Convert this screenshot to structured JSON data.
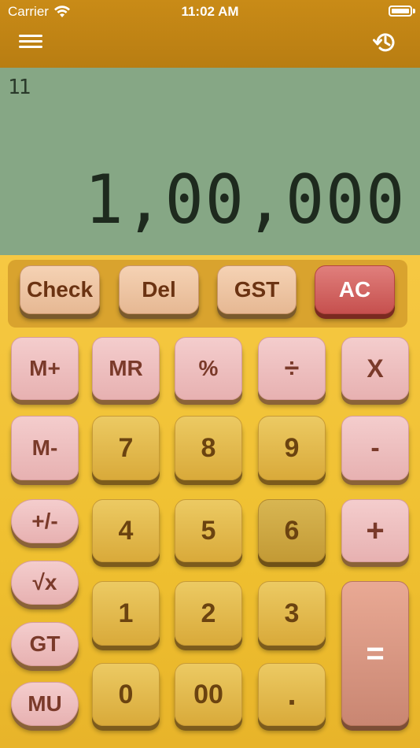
{
  "status": {
    "carrier": "Carrier",
    "time": "11:02 AM",
    "wifi_icon": "wifi-icon",
    "battery_icon": "battery-icon"
  },
  "toolbar": {
    "menu_icon": "hamburger-menu-icon",
    "history_icon": "history-icon"
  },
  "display": {
    "memory_indicator": "11",
    "value": "1,00,000",
    "background": "#86a785"
  },
  "function_keys": {
    "check": "Check",
    "del": "Del",
    "gst": "GST",
    "ac": "AC"
  },
  "keys": {
    "m_plus": "M+",
    "mr": "MR",
    "percent": "%",
    "divide": "÷",
    "multiply": "X",
    "m_minus": "M-",
    "seven": "7",
    "eight": "8",
    "nine": "9",
    "minus": "-",
    "plus_minus": "+/-",
    "four": "4",
    "five": "5",
    "six": "6",
    "plus": "+",
    "sqrt": "√x",
    "one": "1",
    "two": "2",
    "three": "3",
    "equals": "=",
    "gt": "GT",
    "mu": "MU",
    "zero": "0",
    "double_zero": "00",
    "decimal": "."
  },
  "colors": {
    "toolbar": "#c98b17",
    "keypad": "#f3c53a",
    "ac_key": "#c6504e"
  }
}
